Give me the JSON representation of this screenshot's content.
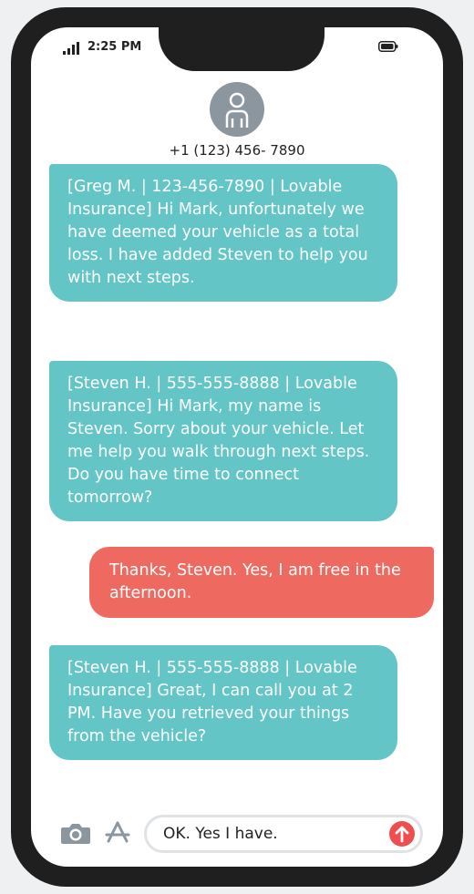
{
  "status_bar": {
    "time": "2:25 PM"
  },
  "contact": {
    "number": "+1 (123) 456- 7890"
  },
  "messages": [
    {
      "direction": "incoming",
      "text": "[Greg M. | 123-456-7890 | Lovable Insurance] Hi Mark, unfortunately we have deemed your vehicle as a total loss. I have added Steven to help you with next steps."
    },
    {
      "direction": "incoming",
      "text": "[Steven H. | 555-555-8888 | Lovable Insurance] Hi Mark, my name is Steven. Sorry about your vehicle. Let me help you walk through next steps. Do you have time to connect tomorrow?"
    },
    {
      "direction": "outgoing",
      "text": "Thanks, Steven. Yes, I am free in the afternoon."
    },
    {
      "direction": "incoming",
      "text": "[Steven H. | 555-555-8888 | Lovable Insurance] Great, I can call you at 2 PM. Have you retrieved your things from the vehicle?"
    }
  ],
  "composer": {
    "text": "OK. Yes I have."
  },
  "colors": {
    "incoming_bubble": "#63c5c6",
    "outgoing_bubble": "#ee6a61",
    "send_button": "#ee4e4e",
    "phone_frame": "#1f1f1f"
  },
  "icons": {
    "camera": "camera-icon",
    "app_store": "app-store-icon",
    "send": "send-arrow-icon",
    "signal": "signal-icon",
    "battery": "battery-icon",
    "avatar": "person-icon"
  }
}
